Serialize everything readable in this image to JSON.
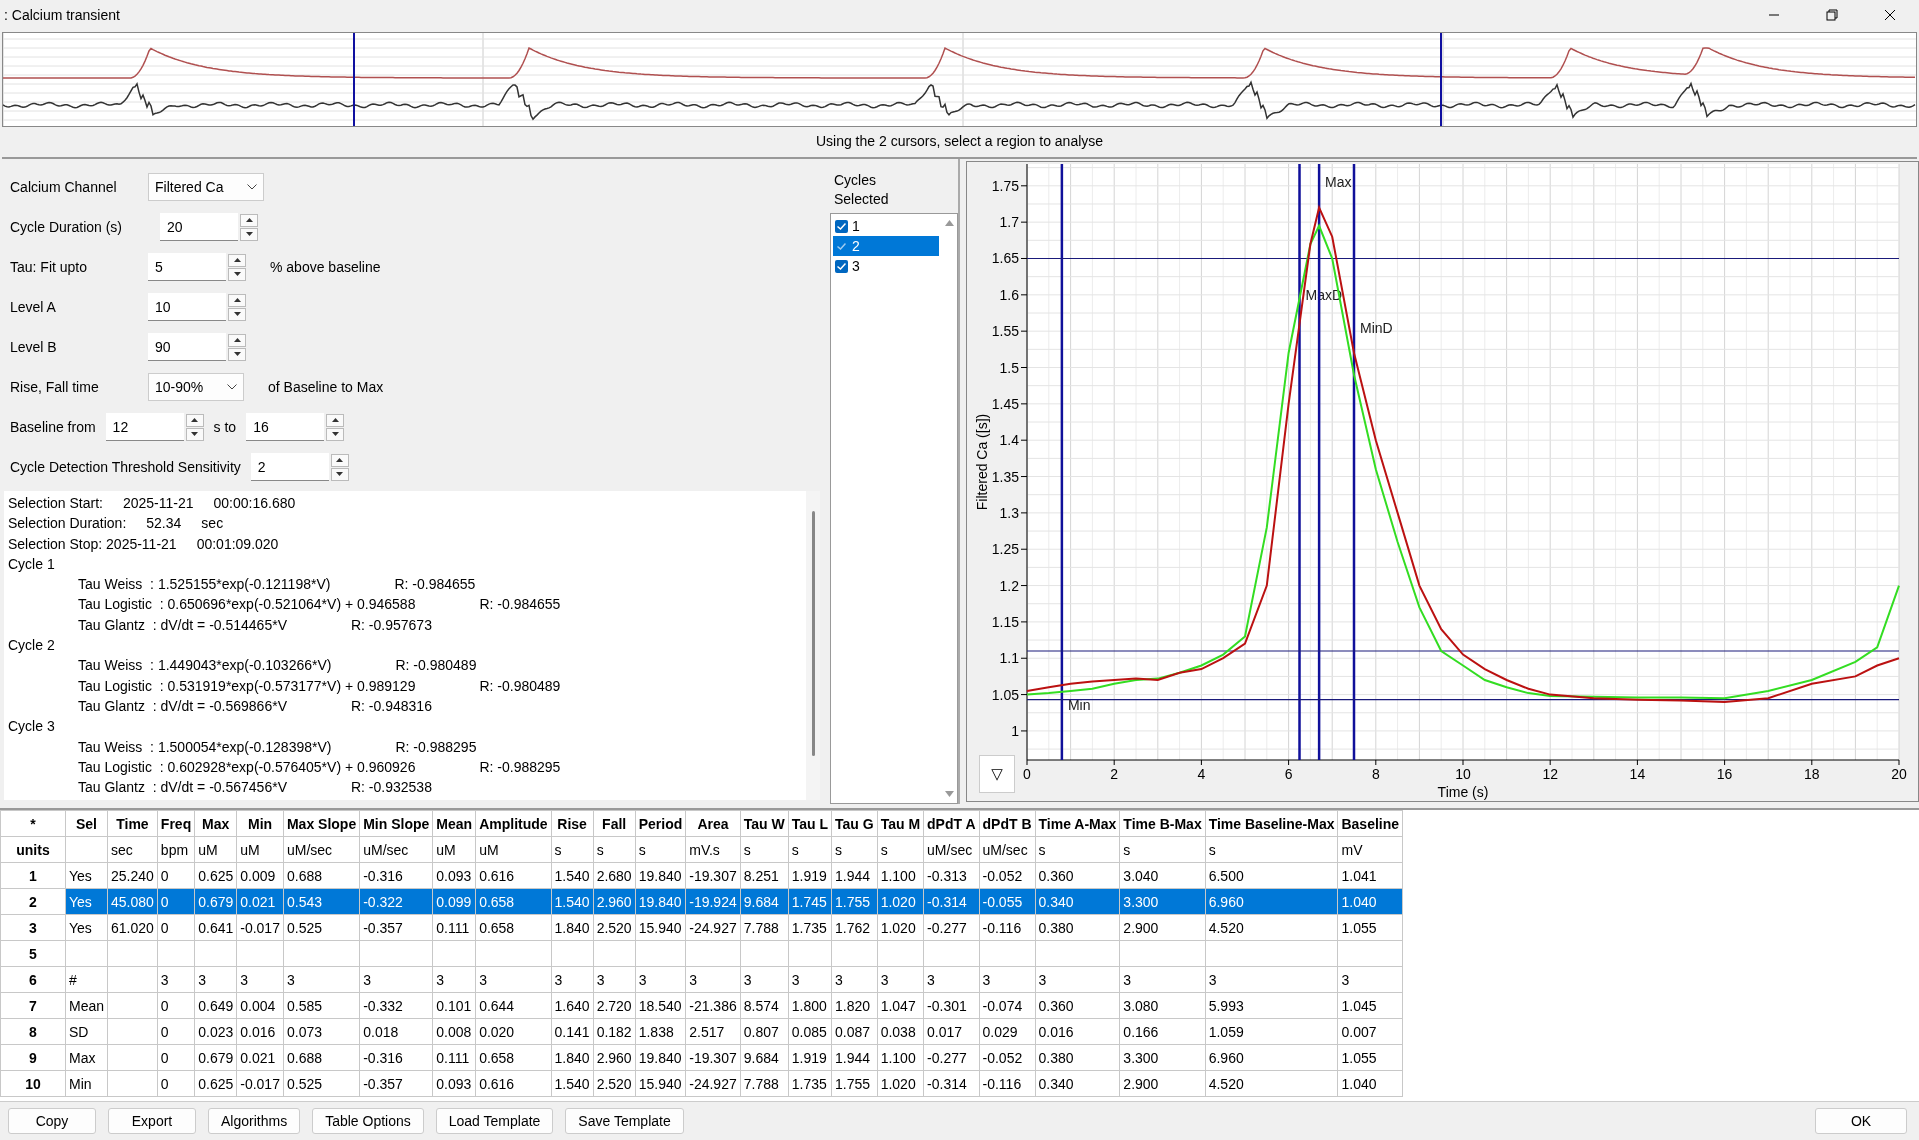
{
  "window": {
    "title": ": Calcium transient"
  },
  "overview": {
    "hint": "Using the 2 cursors, select a region to analyse"
  },
  "settings": [
    {
      "kind": "dropdown",
      "label": "Calcium Channel",
      "value": "Filtered Ca"
    },
    {
      "kind": "spin",
      "label": "Cycle Duration (s)",
      "value": "20"
    },
    {
      "kind": "spin",
      "label": "Tau: Fit upto",
      "value": "5",
      "suffix": "% above baseline"
    },
    {
      "kind": "spin",
      "label": "Level A",
      "value": "10"
    },
    {
      "kind": "spin",
      "label": "Level B",
      "value": "90"
    },
    {
      "kind": "dropdown",
      "label": "Rise, Fall time",
      "value": "10-90%",
      "suffix": "of Baseline to Max"
    },
    {
      "kind": "range",
      "label": "Baseline from",
      "value": "12",
      "middle": "s to",
      "value2": "16"
    },
    {
      "kind": "spin",
      "label": "Cycle Detection Threshold Sensitivity",
      "value": "2"
    }
  ],
  "results": [
    {
      "kind": "plain",
      "parts": [
        "Selection Start:",
        "2025-11-21",
        "00:00:16.680"
      ]
    },
    {
      "kind": "plain",
      "parts": [
        "Selection Duration:",
        "52.34",
        "sec"
      ]
    },
    {
      "kind": "plain",
      "parts": [
        "Selection Stop: 2025-11-21",
        "00:01:09.020"
      ]
    },
    {
      "kind": "plain",
      "parts": [
        "Cycle 1"
      ]
    },
    {
      "kind": "indented",
      "parts": [
        "Tau Weiss  : 1.525155*exp(-0.121198*V)",
        "R: -0.984655"
      ]
    },
    {
      "kind": "indented",
      "parts": [
        "Tau Logistic  : 0.650696*exp(-0.521064*V) + 0.946588",
        "R: -0.984655"
      ]
    },
    {
      "kind": "indented",
      "parts": [
        "Tau Glantz  : dV/dt = -0.514465*V",
        "R: -0.957673"
      ]
    },
    {
      "kind": "plain",
      "parts": [
        "Cycle 2"
      ]
    },
    {
      "kind": "indented",
      "parts": [
        "Tau Weiss  : 1.449043*exp(-0.103266*V)",
        "R: -0.980489"
      ]
    },
    {
      "kind": "indented",
      "parts": [
        "Tau Logistic  : 0.531919*exp(-0.573177*V) + 0.989129",
        "R: -0.980489"
      ]
    },
    {
      "kind": "indented",
      "parts": [
        "Tau Glantz  : dV/dt = -0.569866*V",
        "R: -0.948316"
      ]
    },
    {
      "kind": "plain",
      "parts": [
        "Cycle 3"
      ]
    },
    {
      "kind": "indented",
      "parts": [
        "Tau Weiss  : 1.500054*exp(-0.128398*V)",
        "R: -0.988295"
      ]
    },
    {
      "kind": "indented",
      "parts": [
        "Tau Logistic  : 0.602928*exp(-0.576405*V) + 0.960926",
        "R: -0.988295"
      ]
    },
    {
      "kind": "indented",
      "parts": [
        "Tau Glantz  : dV/dt = -0.567456*V",
        "R: -0.932538"
      ]
    }
  ],
  "cycles": {
    "title": "Cycles Selected",
    "items": [
      {
        "label": "1",
        "checked": true,
        "selected": false
      },
      {
        "label": "2",
        "checked": true,
        "selected": true
      },
      {
        "label": "3",
        "checked": true,
        "selected": false
      }
    ]
  },
  "chart": {
    "toggle": "▽",
    "chart_data": {
      "type": "line",
      "xlabel": "Time (s)",
      "ylabel": "Filtered Ca ([s])",
      "x": [
        0,
        0.5,
        1,
        1.5,
        2,
        2.5,
        3,
        3.5,
        4,
        4.5,
        5,
        5.5,
        6,
        6.5,
        6.7,
        7,
        7.5,
        8,
        8.5,
        9,
        9.5,
        10,
        10.5,
        11,
        11.5,
        12,
        13,
        14,
        15,
        16,
        17,
        18,
        19,
        19.5,
        20
      ],
      "series": [
        {
          "color": "#33dd22",
          "values": [
            1.05,
            1.052,
            1.055,
            1.058,
            1.065,
            1.07,
            1.072,
            1.08,
            1.09,
            1.105,
            1.13,
            1.28,
            1.52,
            1.67,
            1.695,
            1.65,
            1.49,
            1.36,
            1.26,
            1.17,
            1.11,
            1.09,
            1.07,
            1.06,
            1.052,
            1.048,
            1.047,
            1.046,
            1.046,
            1.045,
            1.055,
            1.07,
            1.095,
            1.115,
            1.2
          ]
        },
        {
          "color": "#bb1111",
          "values": [
            1.055,
            1.06,
            1.065,
            1.068,
            1.07,
            1.072,
            1.07,
            1.08,
            1.085,
            1.1,
            1.12,
            1.2,
            1.45,
            1.67,
            1.72,
            1.68,
            1.52,
            1.4,
            1.3,
            1.2,
            1.14,
            1.105,
            1.085,
            1.07,
            1.058,
            1.05,
            1.045,
            1.043,
            1.042,
            1.04,
            1.045,
            1.065,
            1.075,
            1.09,
            1.1
          ]
        }
      ],
      "xlim": [
        0,
        20
      ],
      "ylim": [
        0.96,
        1.78
      ],
      "xticks": [
        0,
        2,
        4,
        6,
        8,
        10,
        12,
        14,
        16,
        18,
        20
      ],
      "grid": true,
      "yticks": [
        1,
        1.05,
        1.1,
        1.15,
        1.2,
        1.25,
        1.3,
        1.35,
        1.4,
        1.45,
        1.5,
        1.55,
        1.6,
        1.65,
        1.7,
        1.75
      ],
      "ref_lines": [
        {
          "axis": "x",
          "value": 0.8,
          "label": "Min"
        },
        {
          "axis": "x",
          "value": 6.25,
          "label": "MaxD"
        },
        {
          "axis": "x",
          "value": 6.7,
          "label": "Max"
        },
        {
          "axis": "x",
          "value": 7.5,
          "label": "MinD"
        },
        {
          "axis": "y",
          "value": 1.65
        },
        {
          "axis": "y",
          "value": 1.11
        },
        {
          "axis": "y",
          "value": 1.043
        }
      ]
    }
  },
  "table": {
    "corner": "*",
    "columns": [
      "Sel",
      "Time",
      "Freq",
      "Max",
      "Min",
      "Max Slope",
      "Min Slope",
      "Mean",
      "Amplitude",
      "Rise",
      "Fall",
      "Period",
      "Area",
      "Tau W",
      "Tau L",
      "Tau G",
      "Tau M",
      "dPdT A",
      "dPdT B",
      "Time A-Max",
      "Time B-Max",
      "Time Baseline-Max",
      "Baseline"
    ],
    "units_label": "units",
    "units": [
      "sec",
      "bpm",
      "uM",
      "uM",
      "uM/sec",
      "uM/sec",
      "uM",
      "uM",
      "s",
      "s",
      "s",
      "mV.s",
      "s",
      "s",
      "s",
      "s",
      "uM/sec",
      "uM/sec",
      "s",
      "s",
      "s",
      "mV"
    ],
    "rows": [
      {
        "label": "1",
        "selected": false,
        "cells": [
          "Yes",
          "25.240",
          "0",
          "0.625",
          "0.009",
          "0.688",
          "-0.316",
          "0.093",
          "0.616",
          "1.540",
          "2.680",
          "19.840",
          "-19.307",
          "8.251",
          "1.919",
          "1.944",
          "1.100",
          "-0.313",
          "-0.052",
          "0.360",
          "3.040",
          "6.500",
          "1.041"
        ]
      },
      {
        "label": "2",
        "selected": true,
        "cells": [
          "Yes",
          "45.080",
          "0",
          "0.679",
          "0.021",
          "0.543",
          "-0.322",
          "0.099",
          "0.658",
          "1.540",
          "2.960",
          "19.840",
          "-19.924",
          "9.684",
          "1.745",
          "1.755",
          "1.020",
          "-0.314",
          "-0.055",
          "0.340",
          "3.300",
          "6.960",
          "1.040"
        ]
      },
      {
        "label": "3",
        "selected": false,
        "cells": [
          "Yes",
          "61.020",
          "0",
          "0.641",
          "-0.017",
          "0.525",
          "-0.357",
          "0.111",
          "0.658",
          "1.840",
          "2.520",
          "15.940",
          "-24.927",
          "7.788",
          "1.735",
          "1.762",
          "1.020",
          "-0.277",
          "-0.116",
          "0.380",
          "2.900",
          "4.520",
          "1.055"
        ]
      },
      {
        "label": "5",
        "selected": false,
        "cells": []
      },
      {
        "label": "6",
        "selected": false,
        "cells": [
          "#",
          null,
          "3",
          "3",
          "3",
          "3",
          "3",
          "3",
          "3",
          "3",
          "3",
          "3",
          "3",
          "3",
          "3",
          "3",
          "3",
          "3",
          "3",
          "3",
          "3",
          "3",
          "3"
        ]
      },
      {
        "label": "7",
        "selected": false,
        "cells": [
          "Mean",
          null,
          "0",
          "0.649",
          "0.004",
          "0.585",
          "-0.332",
          "0.101",
          "0.644",
          "1.640",
          "2.720",
          "18.540",
          "-21.386",
          "8.574",
          "1.800",
          "1.820",
          "1.047",
          "-0.301",
          "-0.074",
          "0.360",
          "3.080",
          "5.993",
          "1.045"
        ]
      },
      {
        "label": "8",
        "selected": false,
        "cells": [
          "SD",
          null,
          "0",
          "0.023",
          "0.016",
          "0.073",
          "0.018",
          "0.008",
          "0.020",
          "0.141",
          "0.182",
          "1.838",
          "2.517",
          "0.807",
          "0.085",
          "0.087",
          "0.038",
          "0.017",
          "0.029",
          "0.016",
          "0.166",
          "1.059",
          "0.007"
        ]
      },
      {
        "label": "9",
        "selected": false,
        "cells": [
          "Max",
          null,
          "0",
          "0.679",
          "0.021",
          "0.688",
          "-0.316",
          "0.111",
          "0.658",
          "1.840",
          "2.960",
          "19.840",
          "-19.307",
          "9.684",
          "1.919",
          "1.944",
          "1.100",
          "-0.277",
          "-0.052",
          "0.380",
          "3.300",
          "6.960",
          "1.055"
        ]
      },
      {
        "label": "10",
        "selected": false,
        "cells": [
          "Min",
          null,
          "0",
          "0.625",
          "-0.017",
          "0.525",
          "-0.357",
          "0.093",
          "0.616",
          "1.540",
          "2.520",
          "15.940",
          "-24.927",
          "7.788",
          "1.735",
          "1.755",
          "1.020",
          "-0.314",
          "-0.116",
          "0.340",
          "2.900",
          "4.520",
          "1.040"
        ]
      }
    ]
  },
  "buttons": [
    "Copy",
    "Export",
    "Algorithms",
    "Table Options",
    "Load Template",
    "Save Template"
  ],
  "ok_button": "OK"
}
